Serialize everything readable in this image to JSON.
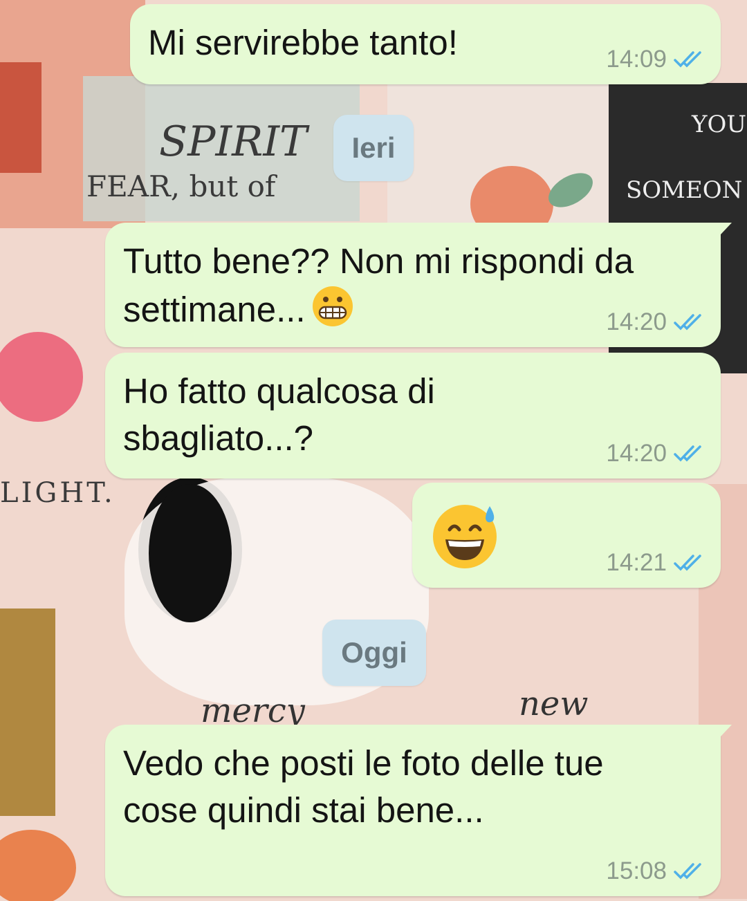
{
  "chat": {
    "messages": [
      {
        "text": "Mi servirebbe tanto!",
        "time": "14:09",
        "status": "read"
      },
      {
        "text": "Tutto bene?? Non mi rispondi da settimane...",
        "emoji": "grimacing-face",
        "time": "14:20",
        "status": "read"
      },
      {
        "text": "Ho fatto qualcosa di sbagliato...?",
        "time": "14:20",
        "status": "read"
      },
      {
        "emoji": "grinning-face-with-sweat",
        "time": "14:21",
        "status": "read"
      },
      {
        "text": "Vedo che posti le foto delle tue cose quindi stai bene...",
        "time": "15:08",
        "status": "read"
      }
    ],
    "date_separators": [
      "Ieri",
      "Oggi"
    ]
  },
  "colors": {
    "outgoing_bubble": "#e6fad4",
    "date_chip": "#cfe4ee",
    "read_ticks": "#4fb0e8",
    "wallpaper_base": "#f1d8ce"
  }
}
